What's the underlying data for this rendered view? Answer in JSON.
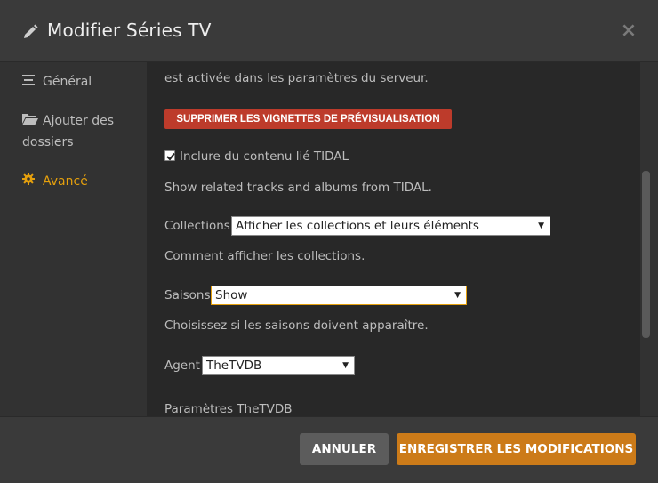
{
  "header": {
    "title": "Modifier Séries TV",
    "close_glyph": "×"
  },
  "sidebar": {
    "items": [
      {
        "label": "Général",
        "icon": "list-icon"
      },
      {
        "label": "Ajouter des",
        "label2": "dossiers",
        "icon": "folder-icon"
      },
      {
        "label": "Avancé",
        "icon": "gear-icon",
        "active": true
      }
    ]
  },
  "content": {
    "partial_text": "est activée dans les paramètres du serveur.",
    "delete_thumbnails_label": "SUPPRIMER LES VIGNETTES DE PRÉVISUALISATION",
    "tidal_checkbox_label": "Inclure du contenu lié TIDAL",
    "tidal_checked": true,
    "tidal_help": "Show related tracks and albums from TIDAL.",
    "collections_label": "Collections",
    "collections_value": "Afficher les collections et leurs éléments",
    "collections_help": "Comment afficher les collections.",
    "seasons_label": "Saisons",
    "seasons_value": "Show",
    "seasons_help": "Choisissez si les saisons doivent apparaître.",
    "agent_label": "Agent",
    "agent_value": "TheTVDB",
    "agent_section": "Paramètres TheTVDB"
  },
  "footer": {
    "cancel_label": "ANNULER",
    "save_label": "ENREGISTRER LES MODIFICATIONS"
  },
  "colors": {
    "accent": "#e5a00d",
    "danger": "#bd3b2b",
    "save": "#cc7b19"
  }
}
